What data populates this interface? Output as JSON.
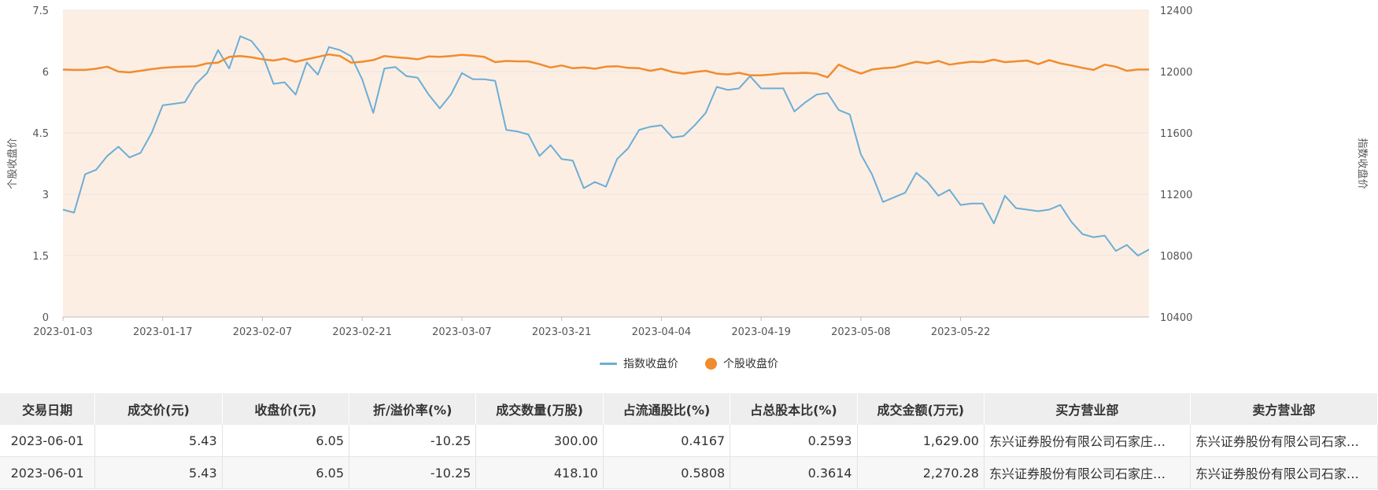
{
  "legend": {
    "index_label": "指数收盘价",
    "stock_label": "个股收盘价"
  },
  "colors": {
    "index_line": "#6baed6",
    "stock_line": "#f08c2e",
    "area_fill": "#fdeee3",
    "grid": "#e6e6e6",
    "axis_text": "#555555",
    "table_header_bg": "#eeeeee"
  },
  "chart_data": {
    "type": "line",
    "x_tick_labels": [
      "2023-01-03",
      "2023-01-17",
      "2023-02-07",
      "2023-02-21",
      "2023-03-07",
      "2023-03-21",
      "2023-04-04",
      "2023-04-19",
      "2023-05-08",
      "2023-05-22"
    ],
    "y_left": {
      "label": "个股收盘价",
      "ticks": [
        "0",
        "1.5",
        "3",
        "4.5",
        "6",
        "7.5"
      ],
      "range": [
        0,
        7.5
      ]
    },
    "y_right": {
      "label": "指数收盘价",
      "ticks": [
        "10400",
        "10800",
        "11200",
        "11600",
        "12000",
        "12400"
      ],
      "range": [
        10400,
        12400
      ]
    },
    "grid": true,
    "legend_position": "bottom",
    "series": [
      {
        "name": "指数收盘价",
        "axis": "right",
        "values": [
          11100,
          11080,
          11330,
          11360,
          11450,
          11510,
          11440,
          11470,
          11600,
          11780,
          11790,
          11800,
          11920,
          11990,
          12140,
          12020,
          12230,
          12200,
          12110,
          11920,
          11930,
          11850,
          12060,
          11980,
          12160,
          12140,
          12100,
          11950,
          11730,
          12020,
          12030,
          11970,
          11960,
          11850,
          11760,
          11850,
          11990,
          11950,
          11950,
          11940,
          11620,
          11610,
          11590,
          11450,
          11520,
          11430,
          11420,
          11240,
          11280,
          11250,
          11430,
          11500,
          11620,
          11640,
          11650,
          11570,
          11580,
          11650,
          11730,
          11900,
          11880,
          11890,
          11970,
          11890,
          11890,
          11890,
          11740,
          11800,
          11850,
          11860,
          11750,
          11720,
          11460,
          11330,
          11150,
          11180,
          11210,
          11340,
          11280,
          11190,
          11230,
          11130,
          11140,
          11140,
          11010,
          11190,
          11110,
          11100,
          11090,
          11100,
          11130,
          11020,
          10940,
          10920,
          10930,
          10830,
          10870,
          10800,
          10840
        ]
      },
      {
        "name": "个股收盘价",
        "axis": "left",
        "values": [
          6.05,
          6.04,
          6.04,
          6.07,
          6.12,
          6.0,
          5.98,
          6.02,
          6.06,
          6.09,
          6.11,
          6.12,
          6.13,
          6.2,
          6.22,
          6.36,
          6.38,
          6.35,
          6.3,
          6.27,
          6.32,
          6.24,
          6.3,
          6.36,
          6.42,
          6.38,
          6.22,
          6.24,
          6.28,
          6.38,
          6.35,
          6.33,
          6.3,
          6.37,
          6.36,
          6.38,
          6.41,
          6.39,
          6.36,
          6.23,
          6.26,
          6.25,
          6.25,
          6.18,
          6.1,
          6.15,
          6.08,
          6.1,
          6.07,
          6.12,
          6.13,
          6.09,
          6.08,
          6.02,
          6.07,
          5.99,
          5.95,
          5.99,
          6.02,
          5.95,
          5.93,
          5.97,
          5.91,
          5.91,
          5.93,
          5.96,
          5.96,
          5.97,
          5.95,
          5.86,
          6.17,
          6.05,
          5.95,
          6.05,
          6.08,
          6.1,
          6.17,
          6.24,
          6.2,
          6.26,
          6.17,
          6.21,
          6.24,
          6.23,
          6.29,
          6.23,
          6.25,
          6.27,
          6.18,
          6.28,
          6.2,
          6.15,
          6.09,
          6.04,
          6.17,
          6.12,
          6.02,
          6.05,
          6.05
        ]
      }
    ]
  },
  "table": {
    "headers": [
      "交易日期",
      "成交价(元)",
      "收盘价(元)",
      "折/溢价率(%)",
      "成交数量(万股)",
      "占流通股比(%)",
      "占总股本比(%)",
      "成交金额(万元)",
      "买方营业部",
      "卖方营业部"
    ],
    "rows": [
      [
        "2023-06-01",
        "5.43",
        "6.05",
        "-10.25",
        "300.00",
        "0.4167",
        "0.2593",
        "1,629.00",
        "东兴证券股份有限公司石家庄…",
        "东兴证券股份有限公司石家…"
      ],
      [
        "2023-06-01",
        "5.43",
        "6.05",
        "-10.25",
        "418.10",
        "0.5808",
        "0.3614",
        "2,270.28",
        "东兴证券股份有限公司石家庄…",
        "东兴证券股份有限公司石家…"
      ]
    ]
  }
}
